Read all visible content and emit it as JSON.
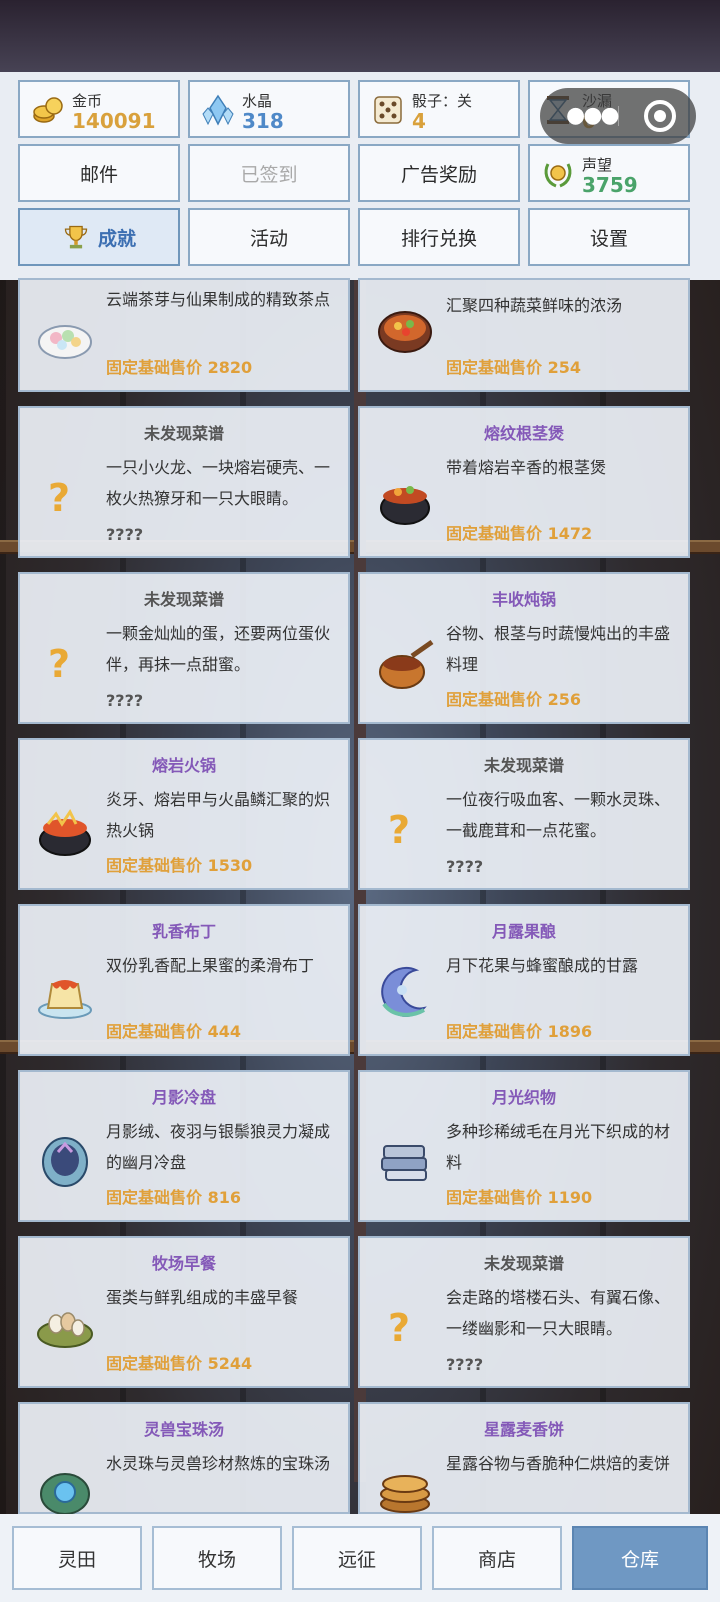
{
  "resources": [
    {
      "label": "金币",
      "value": "140091",
      "color": "#d9a13c",
      "icon": "gold-coins-icon"
    },
    {
      "label": "水晶",
      "value": "318",
      "color": "#4f89c8",
      "icon": "crystal-icon"
    },
    {
      "label": "骰子：关",
      "value": "4",
      "color": "#d9a13c",
      "icon": "dice-icon"
    },
    {
      "label": "沙漏",
      "value": "0",
      "color": "#d9a13c",
      "icon": "hourglass-icon"
    }
  ],
  "row2": {
    "mail": "邮件",
    "signed": "已签到",
    "ad_reward": "广告奖励",
    "reputation": {
      "label": "声望",
      "value": "3759",
      "color": "#4aa36a",
      "icon": "laurel-badge-icon"
    }
  },
  "tabs": {
    "achievements": "成就",
    "activities": "活动",
    "rank_exchange": "排行兑换",
    "settings": "设置"
  },
  "price_prefix": "固定基础售价",
  "cards": [
    {
      "title": "",
      "desc": "云端茶芽与仙果制成的精致茶点",
      "price": "2820",
      "known": true,
      "icon": "tea-dessert-plate-icon"
    },
    {
      "title": "",
      "desc": "汇聚四种蔬菜鲜味的浓汤",
      "price": "254",
      "known": true,
      "icon": "vegetable-soup-icon"
    },
    {
      "title": "未发现菜谱",
      "desc": "一只小火龙、一块熔岩硬壳、一枚火热獠牙和一只大眼睛。",
      "price": "????",
      "known": false,
      "icon": "question-mark-icon"
    },
    {
      "title": "熔纹根茎煲",
      "desc": "带着熔岩辛香的根茎煲",
      "price": "1472",
      "known": true,
      "icon": "root-stew-pot-icon"
    },
    {
      "title": "未发现菜谱",
      "desc": "一颗金灿灿的蛋，还要两位蛋伙伴，再抹一点甜蜜。",
      "price": "????",
      "known": false,
      "icon": "question-mark-icon"
    },
    {
      "title": "丰收炖锅",
      "desc": "谷物、根茎与时蔬慢炖出的丰盛料理",
      "price": "256",
      "known": true,
      "icon": "copper-saucepan-icon"
    },
    {
      "title": "熔岩火锅",
      "desc": "炎牙、熔岩甲与火晶鳞汇聚的炽热火锅",
      "price": "1530",
      "known": true,
      "icon": "lava-hotpot-icon"
    },
    {
      "title": "未发现菜谱",
      "desc": "一位夜行吸血客、一颗水灵珠、一截鹿茸和一点花蜜。",
      "price": "????",
      "known": false,
      "icon": "question-mark-icon"
    },
    {
      "title": "乳香布丁",
      "desc": "双份乳香配上果蜜的柔滑布丁",
      "price": "444",
      "known": true,
      "icon": "pudding-icon"
    },
    {
      "title": "月露果酿",
      "desc": "月下花果与蜂蜜酿成的甘露",
      "price": "1896",
      "known": true,
      "icon": "moon-nectar-icon"
    },
    {
      "title": "月影冷盘",
      "desc": "月影绒、夜羽与银鬃狼灵力凝成的幽月冷盘",
      "price": "816",
      "known": true,
      "icon": "moon-cold-plate-icon"
    },
    {
      "title": "月光织物",
      "desc": "多种珍稀绒毛在月光下织成的材料",
      "price": "1190",
      "known": true,
      "icon": "moonlight-fabric-icon"
    },
    {
      "title": "牧场早餐",
      "desc": "蛋类与鲜乳组成的丰盛早餐",
      "price": "5244",
      "known": true,
      "icon": "egg-basket-icon"
    },
    {
      "title": "未发现菜谱",
      "desc": "会走路的塔楼石头、有翼石像、一缕幽影和一只大眼睛。",
      "price": "????",
      "known": false,
      "icon": "question-mark-icon"
    },
    {
      "title": "灵兽宝珠汤",
      "desc": "水灵珠与灵兽珍材熬炼的宝珠汤",
      "price": "",
      "known": true,
      "icon": "orb-soup-icon"
    },
    {
      "title": "星露麦香饼",
      "desc": "星露谷物与香脆种仁烘焙的麦饼",
      "price": "",
      "known": true,
      "icon": "wheat-pancake-icon"
    }
  ],
  "nav": [
    "灵田",
    "牧场",
    "远征",
    "商店",
    "仓库"
  ],
  "nav_active": 4
}
